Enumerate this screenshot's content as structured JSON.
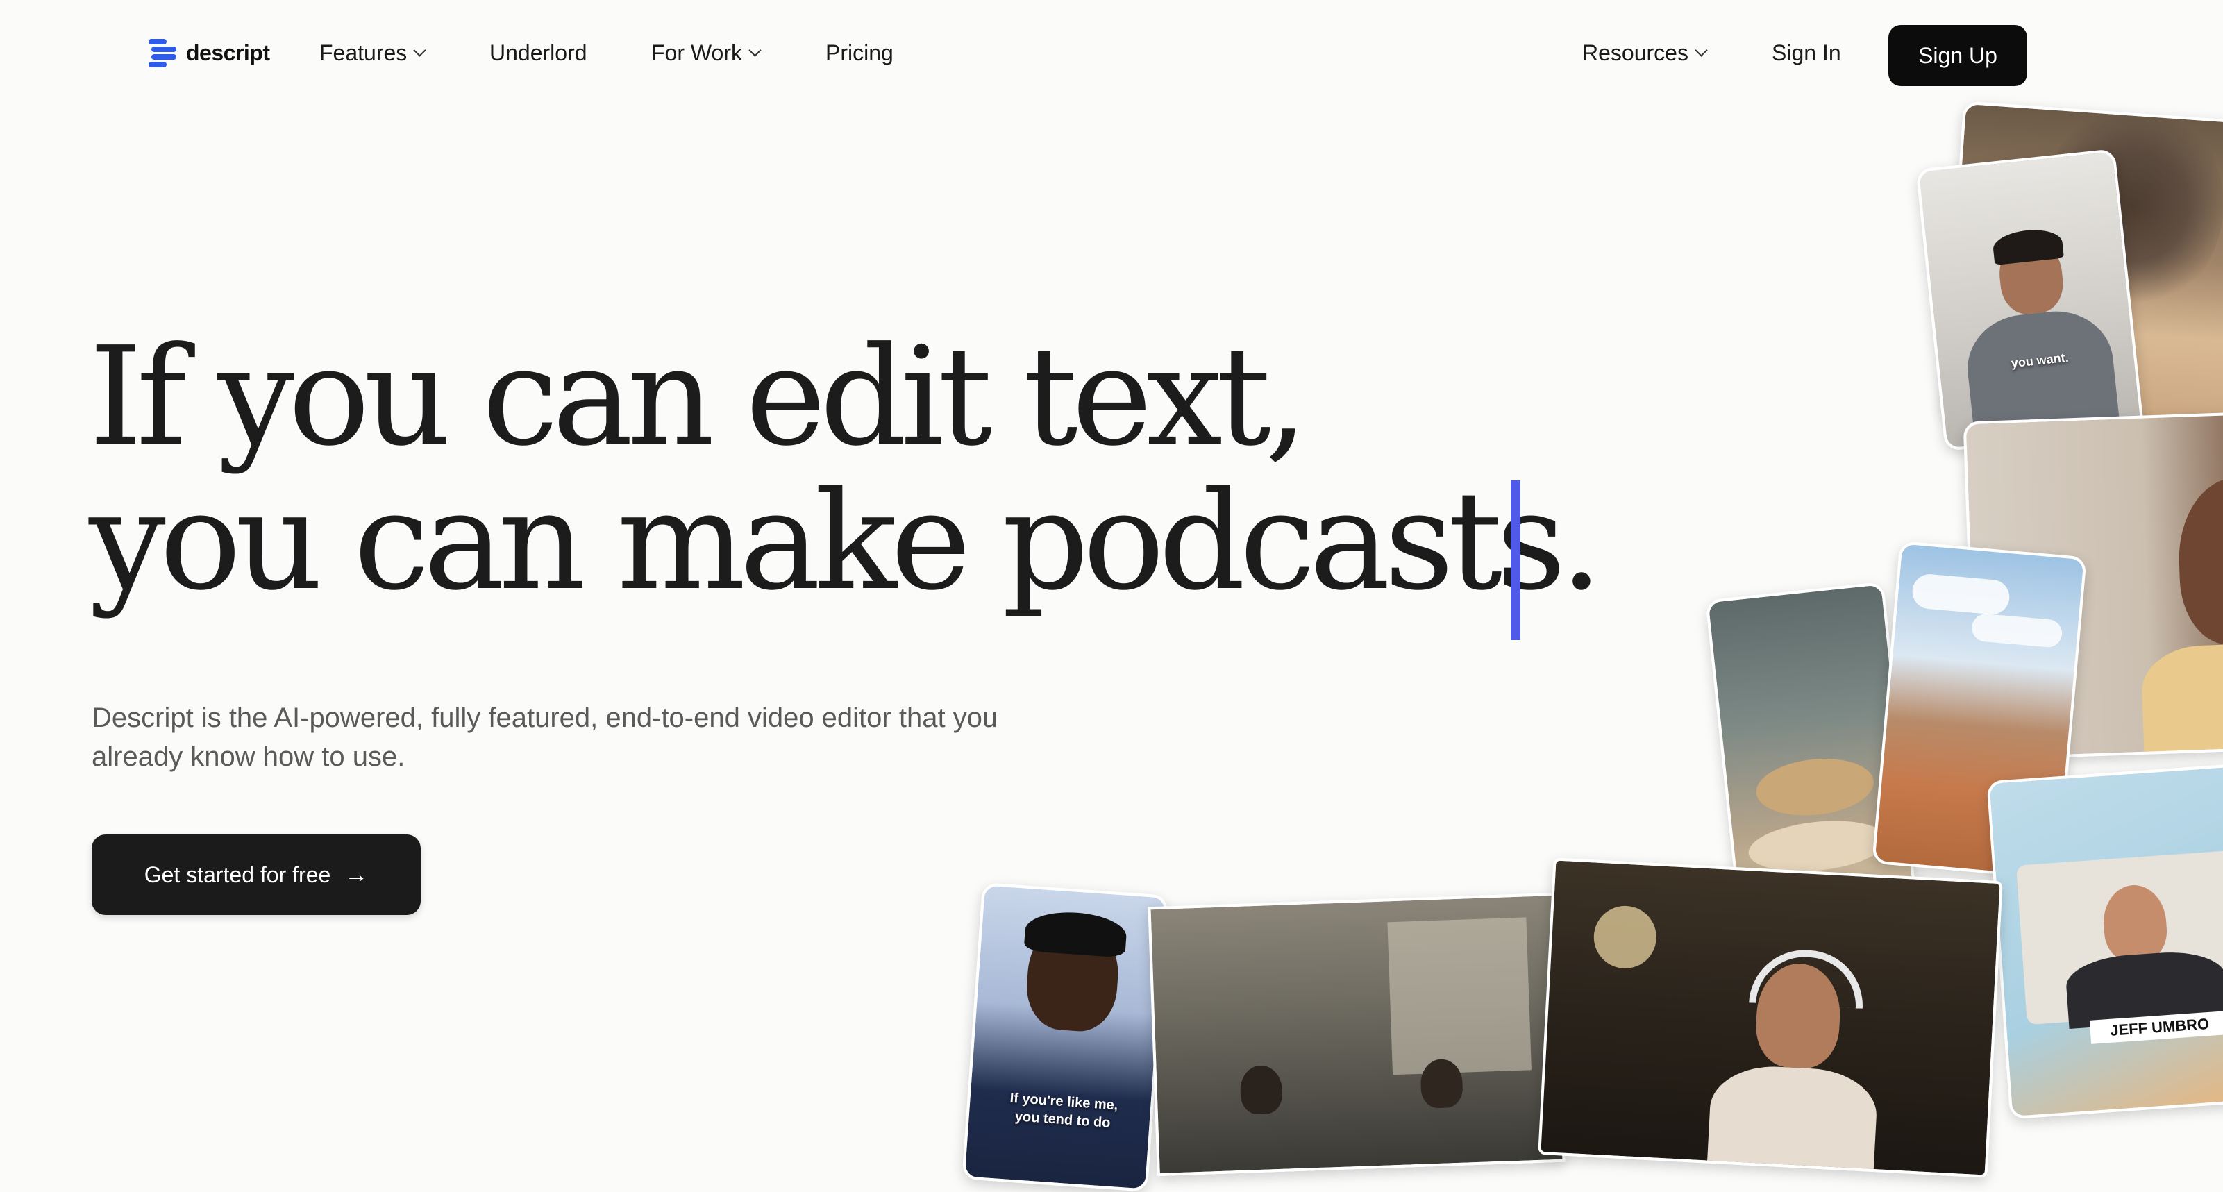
{
  "nav": {
    "brand": "descript",
    "items": [
      "Features",
      "Underlord",
      "For Work",
      "Pricing"
    ],
    "resources": "Resources",
    "sign_in": "Sign In",
    "sign_up": "Sign Up"
  },
  "hero": {
    "line1": "If you can edit text,",
    "line2": "you can make podcasts.",
    "subtitle": "Descript is the AI-powered, fully featured, end-to-end video editor that you already know how to use.",
    "cta": "Get started for free"
  },
  "collage": {
    "caption_tiktok": "you want.",
    "caption_subtitle_1": "If you're like me,",
    "caption_subtitle_2": "you tend to do",
    "highlight_word": "like",
    "name_tag": "JEFF UMBRO"
  },
  "colors": {
    "accent": "#4f5be8",
    "brand_blue": "#2f5bea",
    "button": "#0c0c0c",
    "background": "#fbfbfa"
  }
}
